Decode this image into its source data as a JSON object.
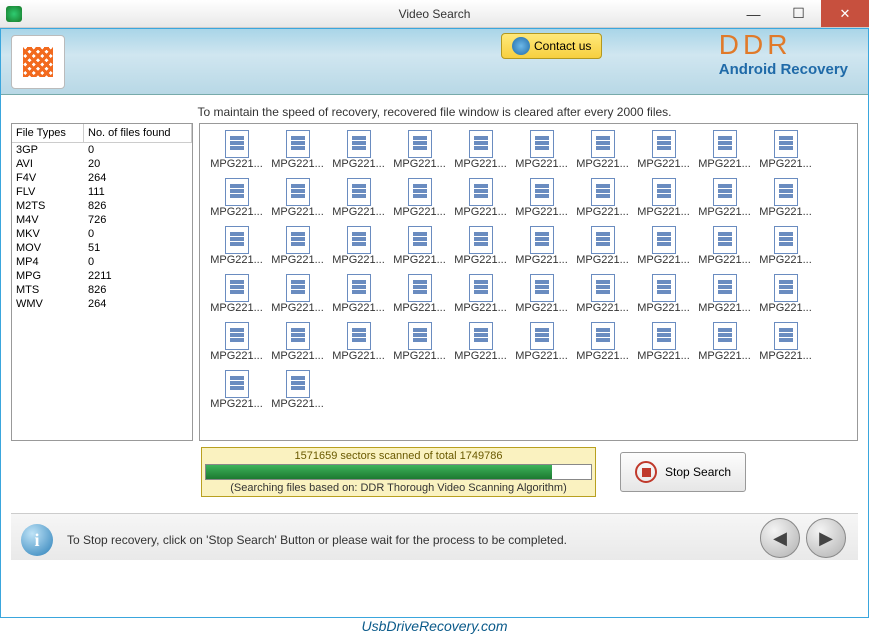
{
  "window": {
    "title": "Video Search"
  },
  "banner": {
    "contact_label": "Contact us",
    "brand": "DDR",
    "brand_sub": "Android Recovery"
  },
  "notice": "To maintain the speed of recovery, recovered file window is cleared after every 2000 files.",
  "file_table": {
    "col1": "File Types",
    "col2": "No. of files found",
    "rows": [
      {
        "type": "3GP",
        "count": "0"
      },
      {
        "type": "AVI",
        "count": "20"
      },
      {
        "type": "F4V",
        "count": "264"
      },
      {
        "type": "FLV",
        "count": "111"
      },
      {
        "type": "M2TS",
        "count": "826"
      },
      {
        "type": "M4V",
        "count": "726"
      },
      {
        "type": "MKV",
        "count": "0"
      },
      {
        "type": "MOV",
        "count": "51"
      },
      {
        "type": "MP4",
        "count": "0"
      },
      {
        "type": "MPG",
        "count": "2211"
      },
      {
        "type": "MTS",
        "count": "826"
      },
      {
        "type": "WMV",
        "count": "264"
      }
    ]
  },
  "grid": {
    "item_label": "MPG221...",
    "count": 52
  },
  "progress": {
    "sectors_text": "1571659 sectors scanned of total 1749786",
    "algo_text": "(Searching files based on:  DDR Thorough Video Scanning Algorithm)"
  },
  "stop_label": "Stop Search",
  "footer": {
    "info": "To Stop recovery, click on 'Stop Search' Button or please wait for the process to be completed.",
    "url": "UsbDriveRecovery.com"
  }
}
